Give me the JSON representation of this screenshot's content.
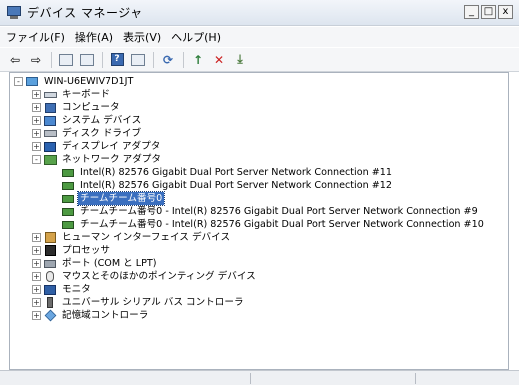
{
  "window": {
    "title": "デバイス マネージャ",
    "controls": [
      "_",
      "□",
      "x"
    ]
  },
  "menu": [
    {
      "label": "ファイル(F)"
    },
    {
      "label": "操作(A)"
    },
    {
      "label": "表示(V)"
    },
    {
      "label": "ヘルプ(H)"
    }
  ],
  "toolbar": {
    "back": "⇦",
    "forward": "⇨"
  },
  "tree": {
    "root": {
      "label": "WIN-U6EWIV7D1JT"
    },
    "items": [
      {
        "label": "キーボード",
        "expander": "+"
      },
      {
        "label": "コンピュータ",
        "expander": "+"
      },
      {
        "label": "システム デバイス",
        "expander": "+"
      },
      {
        "label": "ディスク ドライブ",
        "expander": "+"
      },
      {
        "label": "ディスプレイ アダプタ",
        "expander": "+"
      },
      {
        "label": "ネットワーク アダプタ",
        "expander": "-"
      },
      {
        "label": "Intel(R) 82576 Gigabit Dual Port Server Network Connection #11"
      },
      {
        "label": "Intel(R) 82576 Gigabit Dual Port Server Network Connection #12"
      },
      {
        "label": "チームチーム番号0"
      },
      {
        "label": "チームチーム番号0 - Intel(R) 82576 Gigabit Dual Port Server Network Connection #9"
      },
      {
        "label": "チームチーム番号0 - Intel(R) 82576 Gigabit Dual Port Server Network Connection #10"
      },
      {
        "label": "ヒューマン インターフェイス デバイス",
        "expander": "+"
      },
      {
        "label": "プロセッサ",
        "expander": "+"
      },
      {
        "label": "ポート (COM と LPT)",
        "expander": "+"
      },
      {
        "label": "マウスとそのほかのポインティング デバイス",
        "expander": "+"
      },
      {
        "label": "モニタ",
        "expander": "+"
      },
      {
        "label": "ユニバーサル シリアル バス コントローラ",
        "expander": "+"
      },
      {
        "label": "記憶域コントローラ",
        "expander": "+"
      }
    ]
  }
}
